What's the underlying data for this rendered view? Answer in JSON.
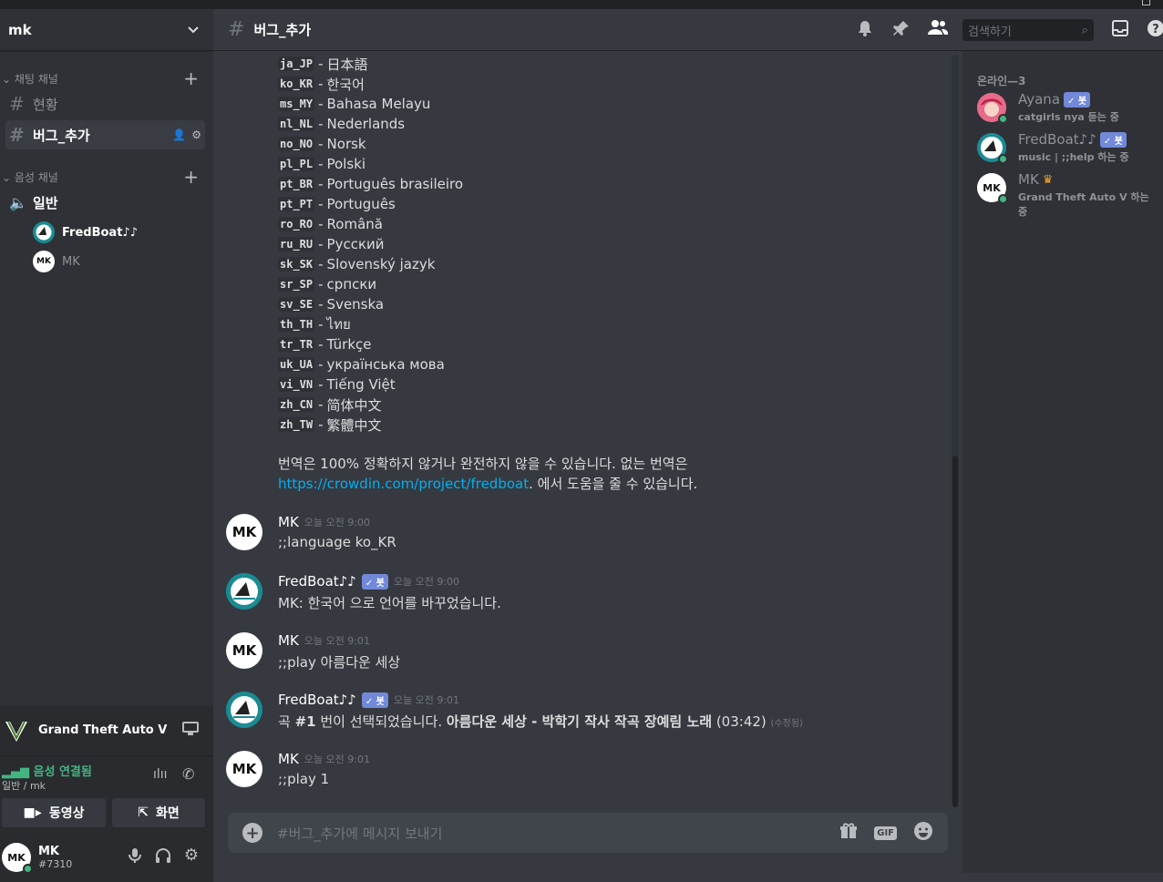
{
  "server": {
    "name": "mk"
  },
  "sidebar": {
    "text_category": "채팅 채널",
    "voice_category": "음성 채널",
    "channels": [
      {
        "name": "현황"
      },
      {
        "name": "버그_추가"
      }
    ],
    "voice_channel": "일반",
    "voice_users": [
      {
        "name": "FredBoat♪♪"
      },
      {
        "name": "MK",
        "avatar": "MK"
      }
    ]
  },
  "game_activity": {
    "title": "Grand Theft Auto V"
  },
  "voice_status": {
    "status": "음성 연결됨",
    "location": "일반 / mk",
    "video_label": "동영상",
    "screen_label": "화면"
  },
  "user": {
    "name": "MK",
    "tag": "#7310",
    "avatar": "MK"
  },
  "header": {
    "channel_name": "버그_추가",
    "search_placeholder": "검색하기"
  },
  "languages": [
    {
      "code": "ja_JP",
      "name": "日本語"
    },
    {
      "code": "ko_KR",
      "name": "한국어"
    },
    {
      "code": "ms_MY",
      "name": "Bahasa Melayu"
    },
    {
      "code": "nl_NL",
      "name": "Nederlands"
    },
    {
      "code": "no_NO",
      "name": "Norsk"
    },
    {
      "code": "pl_PL",
      "name": "Polski"
    },
    {
      "code": "pt_BR",
      "name": "Português brasileiro"
    },
    {
      "code": "pt_PT",
      "name": "Português"
    },
    {
      "code": "ro_RO",
      "name": "Română"
    },
    {
      "code": "ru_RU",
      "name": "Русский"
    },
    {
      "code": "sk_SK",
      "name": "Slovenský jazyk"
    },
    {
      "code": "sr_SP",
      "name": "српски"
    },
    {
      "code": "sv_SE",
      "name": "Svenska"
    },
    {
      "code": "th_TH",
      "name": "ไทย"
    },
    {
      "code": "tr_TR",
      "name": "Türkçe"
    },
    {
      "code": "uk_UA",
      "name": "українська мова"
    },
    {
      "code": "vi_VN",
      "name": "Tiếng Việt"
    },
    {
      "code": "zh_CN",
      "name": "简体中文"
    },
    {
      "code": "zh_TW",
      "name": "繁體中文"
    }
  ],
  "translation_note": {
    "line1": "번역은 100% 정확하지 않거나 완전하지 않을 수 있습니다. 없는 번역은",
    "link": "https://crowdin.com/project/fredboat",
    "line2_suffix": ". 에서 도움을 줄 수 있습니다."
  },
  "messages": [
    {
      "author": "MK",
      "avatar": "MK",
      "time": "오늘 오전 9:00",
      "text": ";;language ko_KR"
    },
    {
      "author": "FredBoat♪♪",
      "bot_tag": "✓ 봇",
      "time": "오늘 오전 9:00",
      "text": "MK:  한국어 으로 언어를 바꾸었습니다."
    },
    {
      "author": "MK",
      "avatar": "MK",
      "time": "오늘 오전 9:01",
      "text": ";;play 아름다운 세상"
    },
    {
      "author": "FredBoat♪♪",
      "bot_tag": "✓ 봇",
      "time": "오늘 오전 9:01",
      "text_pre": "곡 ",
      "text_bold1": "#1",
      "text_mid": " 번이 선택되었습니다. ",
      "text_bold2": "아름다운 세상 - 박학기 작사 작곡 장예림 노래",
      "text_post": " (03:42)",
      "edited": "(수정됨)"
    },
    {
      "author": "MK",
      "avatar": "MK",
      "time": "오늘 오전 9:01",
      "text": ";;play 1"
    }
  ],
  "input": {
    "placeholder": "#버그_추가에 메시지 보내기",
    "gif_label": "GIF"
  },
  "members": {
    "category": "온라인—3",
    "list": [
      {
        "name": "Ayana",
        "bot_tag": "✓ 봇",
        "activity": "catgirls nya 듣는 중"
      },
      {
        "name": "FredBoat♪♪",
        "bot_tag": "✓ 봇",
        "activity": "music | ;;help 하는 중"
      },
      {
        "name": "MK",
        "avatar": "MK",
        "crown": "♛",
        "activity": "Grand Theft Auto V 하는 중"
      }
    ]
  },
  "colors": {
    "online": "#43b581",
    "link": "#00b0f4",
    "bot_tag": "#7289da",
    "crown": "#faa61a"
  }
}
